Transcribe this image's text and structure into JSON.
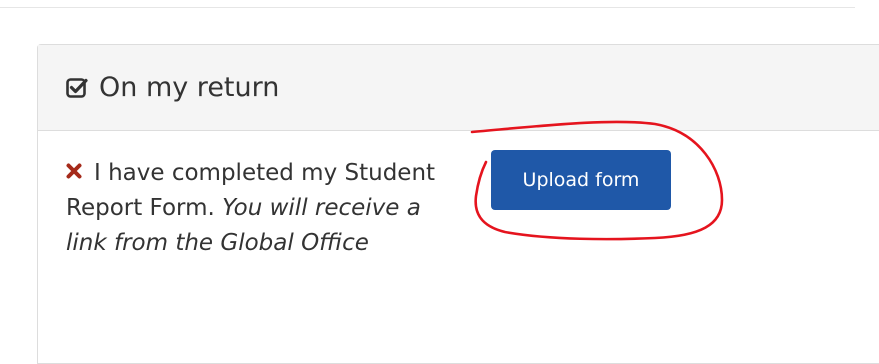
{
  "section": {
    "title": "On my return",
    "icon": "check-square-icon"
  },
  "checklist_item": {
    "status_icon": "cross-icon",
    "status_color": "#a52a1a",
    "text": "I have completed my Student Report Form. ",
    "note": "You will receive a link from the Global Office",
    "button_label": "Upload form"
  },
  "colors": {
    "button": "#1f58a8",
    "annotation": "#e5141e"
  }
}
